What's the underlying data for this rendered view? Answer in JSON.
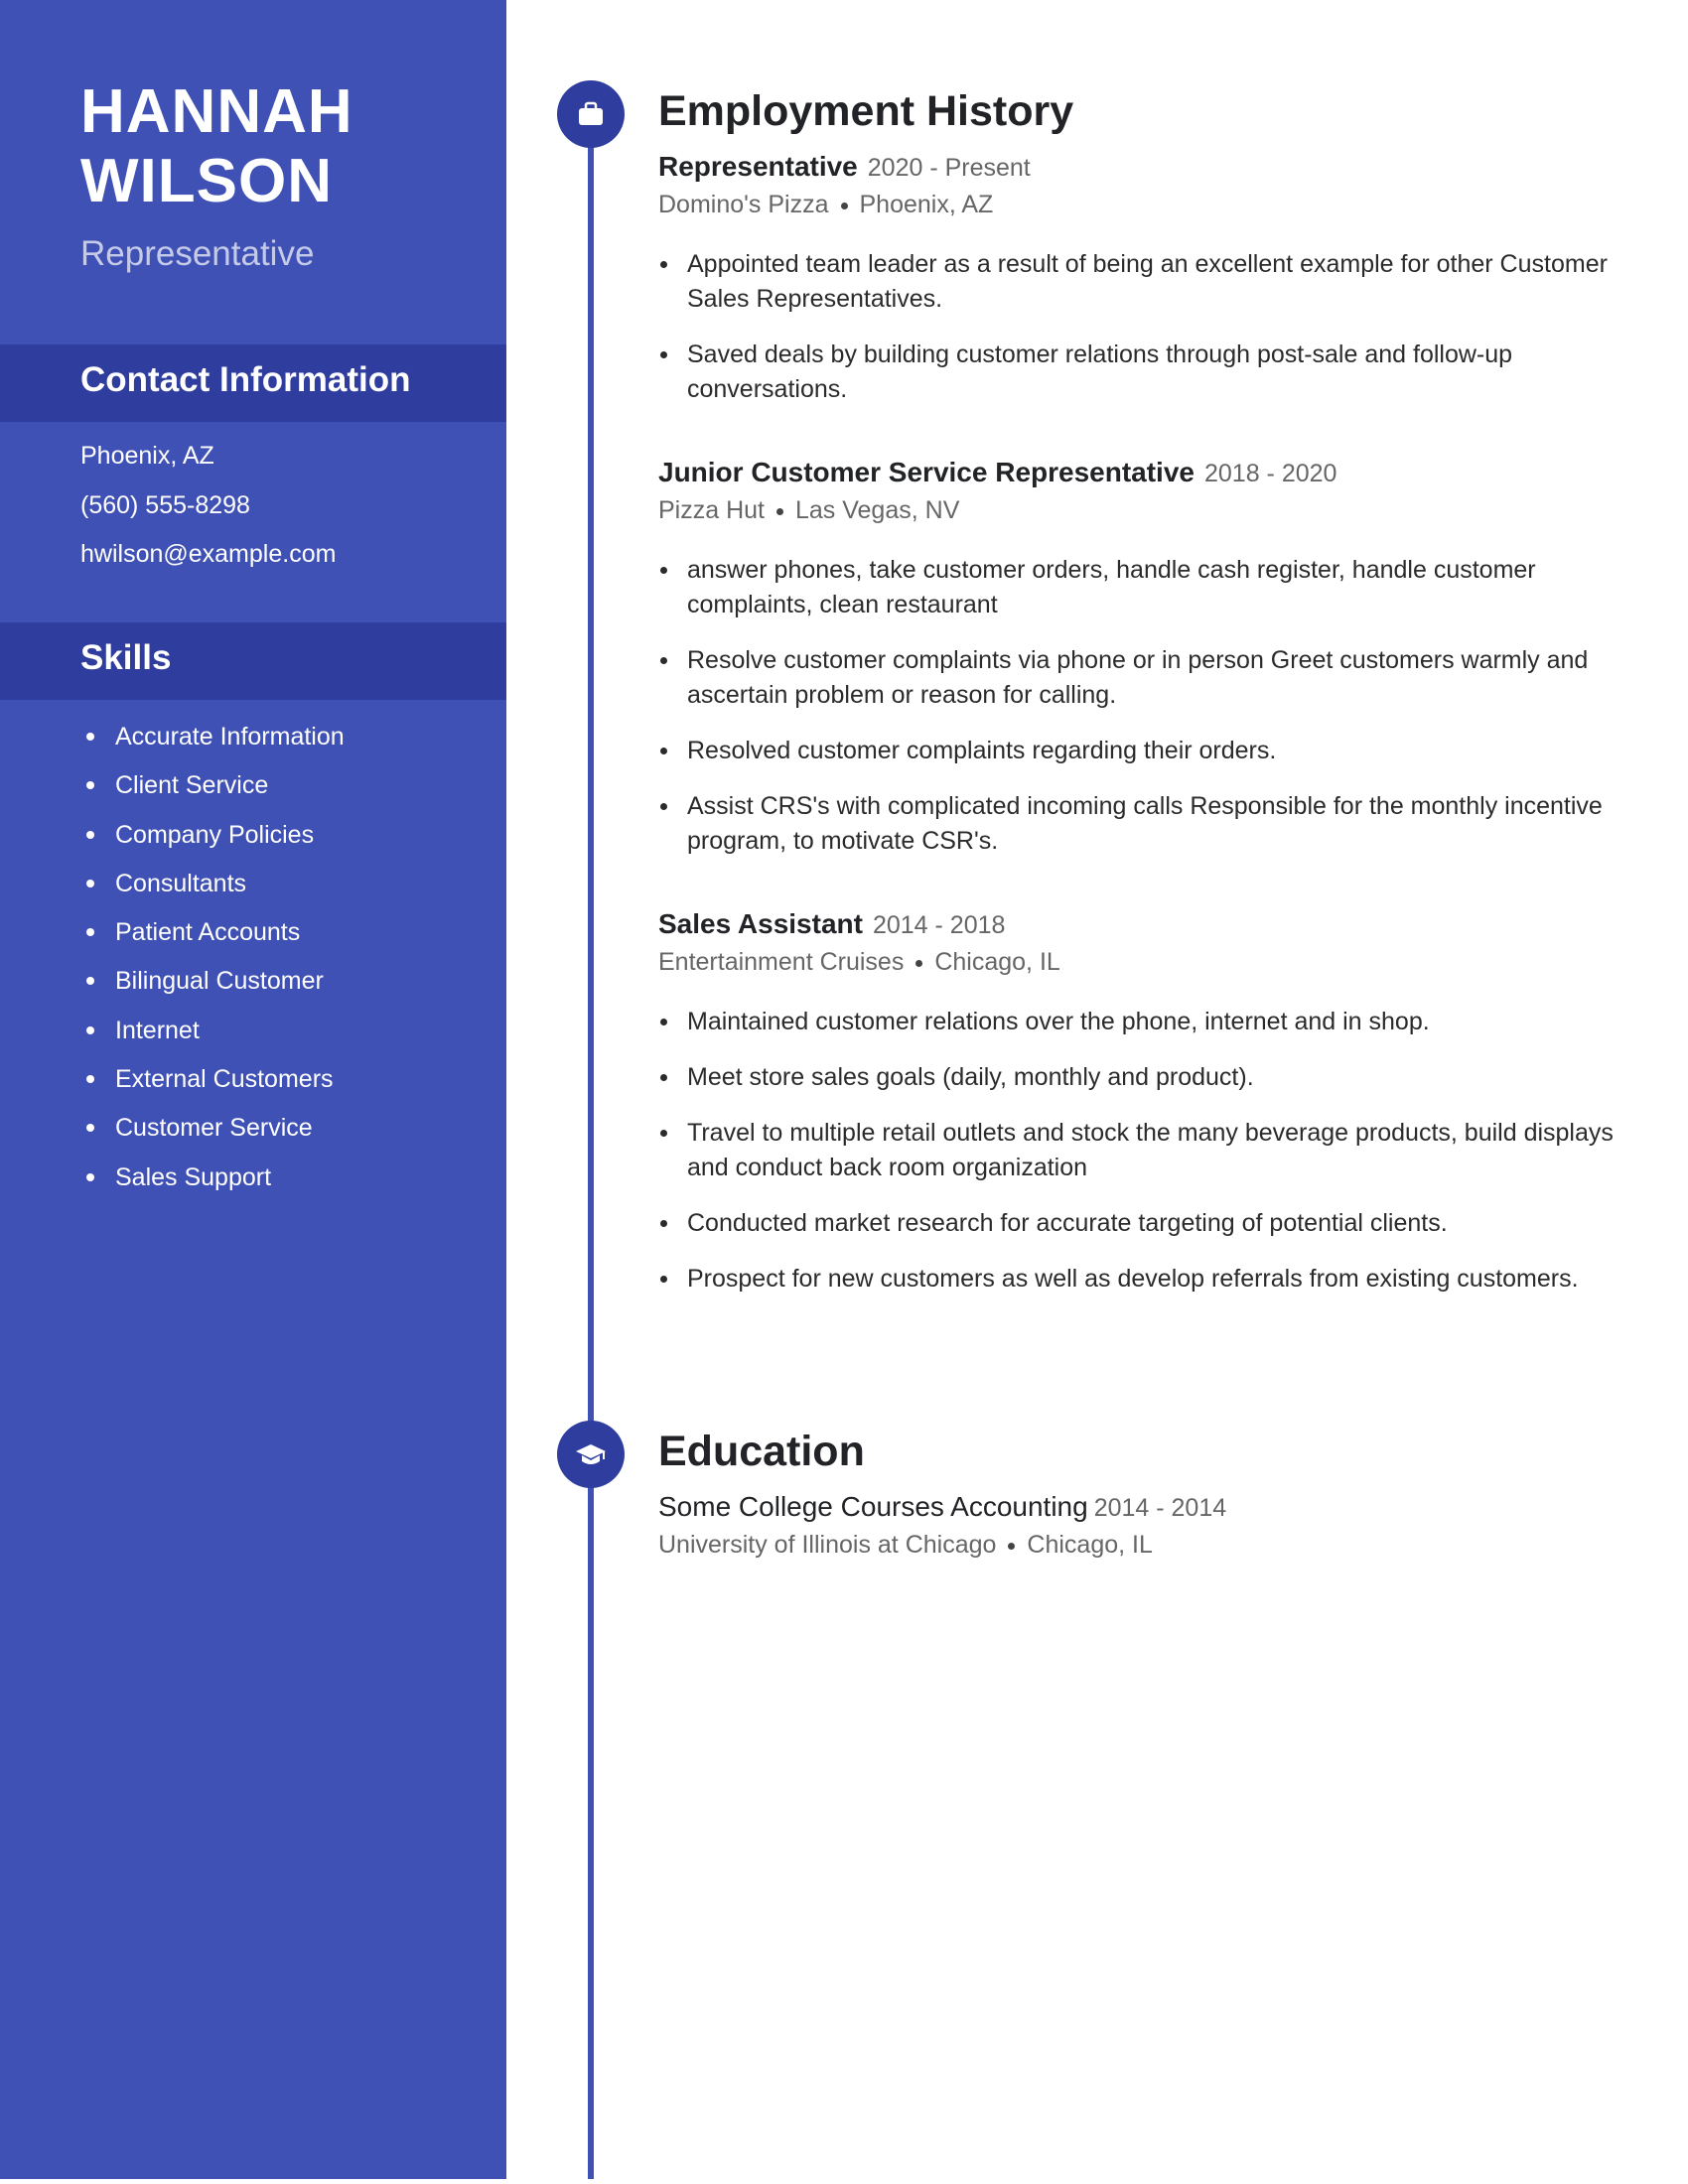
{
  "person": {
    "first_name": "HANNAH",
    "last_name": "WILSON",
    "title": "Representative"
  },
  "contact": {
    "heading": "Contact Information",
    "location": "Phoenix, AZ",
    "phone": "(560) 555-8298",
    "email": "hwilson@example.com"
  },
  "skills": {
    "heading": "Skills",
    "items": [
      "Accurate Information",
      "Client Service",
      "Company Policies",
      "Consultants",
      "Patient Accounts",
      "Bilingual Customer",
      "Internet",
      "External Customers",
      "Customer Service",
      "Sales Support"
    ]
  },
  "employment": {
    "heading": "Employment History",
    "icon": "briefcase-icon",
    "jobs": [
      {
        "title": "Representative",
        "dates": "2020 - Present",
        "company": "Domino's Pizza",
        "location": "Phoenix, AZ",
        "bullets": [
          "Appointed team leader as a result of being an excellent example for other Customer Sales Representatives.",
          "Saved deals by building customer relations through post-sale and follow-up conversations."
        ]
      },
      {
        "title": "Junior Customer Service Representative",
        "dates": "2018 - 2020",
        "company": "Pizza Hut",
        "location": "Las Vegas, NV",
        "bullets": [
          "answer phones, take customer orders, handle cash register, handle customer complaints, clean restaurant",
          "Resolve customer complaints via phone or in person Greet customers warmly and ascertain problem or reason for calling.",
          "Resolved customer complaints regarding their orders.",
          "Assist CRS's with complicated incoming calls Responsible for the monthly incentive program, to motivate CSR's."
        ]
      },
      {
        "title": "Sales Assistant",
        "dates": "2014 - 2018",
        "company": "Entertainment Cruises",
        "location": "Chicago, IL",
        "bullets": [
          "Maintained customer relations over the phone, internet and in shop.",
          "Meet store sales goals (daily, monthly and product).",
          "Travel to multiple retail outlets and stock the many beverage products, build displays and conduct back room organization",
          "Conducted market research for accurate targeting of potential clients.",
          "Prospect for new customers as well as develop referrals from existing customers."
        ]
      }
    ]
  },
  "education": {
    "heading": "Education",
    "icon": "graduation-cap-icon",
    "entries": [
      {
        "degree": "Some College Courses Accounting",
        "dates": "2014 - 2014",
        "school": "University of Illinois at Chicago",
        "location": "Chicago, IL"
      }
    ]
  },
  "colors": {
    "sidebar": "#3f51b5",
    "sidebar_band": "#2f3d9e",
    "accent": "#3f51b5",
    "subtitle": "#c5cae9",
    "text": "#222326",
    "muted": "#666666"
  }
}
